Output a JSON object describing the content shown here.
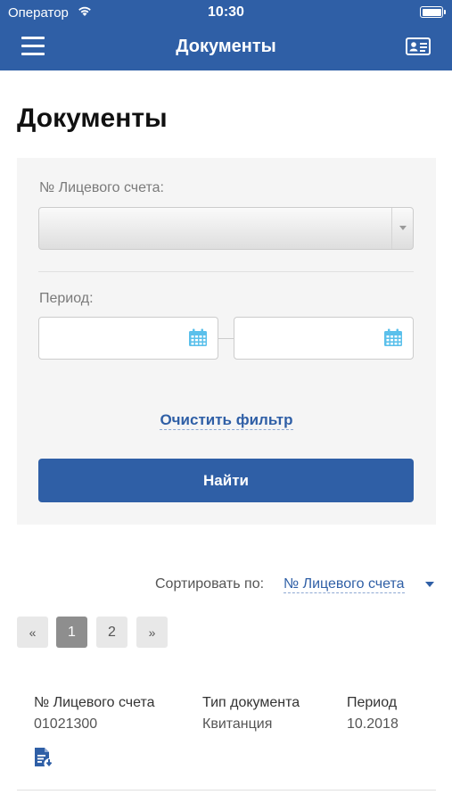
{
  "status_bar": {
    "carrier": "Оператор",
    "time": "10:30"
  },
  "nav": {
    "title": "Документы"
  },
  "page": {
    "title": "Документы"
  },
  "filter": {
    "account_label": "№ Лицевого счета:",
    "account_value": "",
    "period_label": "Период:",
    "date_from": "",
    "date_to": "",
    "clear_label": "Очистить фильтр",
    "find_label": "Найти"
  },
  "sort": {
    "label": "Сортировать по:",
    "value": "№ Лицевого счета"
  },
  "pagination": {
    "prev": "«",
    "pages": [
      "1",
      "2"
    ],
    "next": "»",
    "current": "1"
  },
  "table": {
    "headers": [
      "№ Лицевого счета",
      "Тип документа",
      "Период"
    ],
    "rows": [
      {
        "account": "01021300",
        "type": "Квитанция",
        "period": "10.2018",
        "icon": "document-download-icon"
      }
    ]
  },
  "colors": {
    "brand": "#2f5fa6",
    "calendar": "#5bc0eb"
  }
}
